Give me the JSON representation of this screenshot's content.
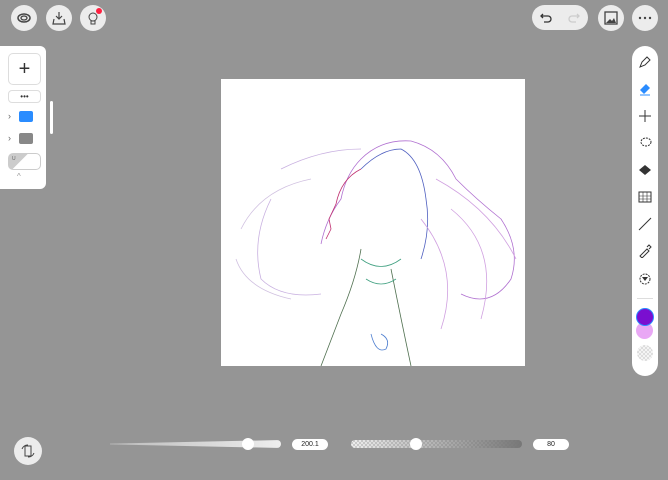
{
  "top_left": {
    "buttons": [
      "gallery-icon",
      "import-icon",
      "tips-icon"
    ]
  },
  "top_right": {
    "buttons": [
      "undo-icon",
      "redo-icon",
      "reference-image-icon",
      "more-icon"
    ]
  },
  "layers": {
    "add_label": "+",
    "more_label": "•••",
    "expand_label": "^",
    "layer_letter": "U"
  },
  "tools": [
    "pen",
    "eraser",
    "move",
    "lasso",
    "fill",
    "grid",
    "line",
    "eyedropper",
    "symmetry"
  ],
  "colors": {
    "primary": "#7a0fd0",
    "secondary": "#e9a8f5",
    "accent": "#2a8cff",
    "badge": "#ff2040"
  },
  "bottom": {
    "size_value": "200.1",
    "size_level": 0.69,
    "opacity_value": "80",
    "opacity_level": 0.38
  }
}
